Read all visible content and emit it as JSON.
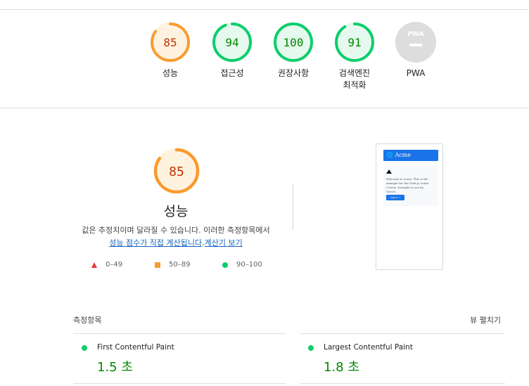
{
  "summary_gauges": [
    {
      "score": "85",
      "score_value": 85,
      "label": "성능",
      "label_line2": "",
      "color": "#fa9b2f",
      "track": "#fff3e0",
      "text_color": "#c33300"
    },
    {
      "score": "94",
      "score_value": 94,
      "label": "접근성",
      "label_line2": "",
      "color": "#0cce6b",
      "track": "#e6f9ee",
      "text_color": "#008800"
    },
    {
      "score": "100",
      "score_value": 100,
      "label": "권장사항",
      "label_line2": "",
      "color": "#0cce6b",
      "track": "#e6f9ee",
      "text_color": "#008800"
    },
    {
      "score": "91",
      "score_value": 91,
      "label": "검색엔진",
      "label_line2": "최적화",
      "color": "#0cce6b",
      "track": "#e6f9ee",
      "text_color": "#008800"
    }
  ],
  "pwa": {
    "badge_text": "PWA",
    "label": "PWA",
    "color": "#dddddd"
  },
  "performance": {
    "score": "85",
    "score_value": 85,
    "title": "성능",
    "desc_line1": "값은 추정치이며 달라질 수 있습니다. 이러한 측정항목에서",
    "link1": "성능 점수가 직접 계산됩니다",
    "period": ".",
    "link2": "계산기 보기"
  },
  "legend": [
    {
      "shape": "triangle",
      "range": "0–49",
      "color": "#e53935"
    },
    {
      "shape": "square",
      "range": "50–89",
      "color": "#fa9b2f"
    },
    {
      "shape": "circle",
      "range": "90–100",
      "color": "#0cce6b"
    }
  ],
  "thumbnail": {
    "brand": "Acme",
    "text": "Welcome to Acme. This is the example for the Next.js Learn Course, brought to you by Vercel.",
    "button": "Log in →"
  },
  "metrics": {
    "header": "측정항목",
    "expand_label": "뷰 펼치기",
    "items": [
      {
        "name": "First Contentful Paint",
        "value": "1.5 초"
      },
      {
        "name": "Largest Contentful Paint",
        "value": "1.8 초"
      }
    ]
  }
}
